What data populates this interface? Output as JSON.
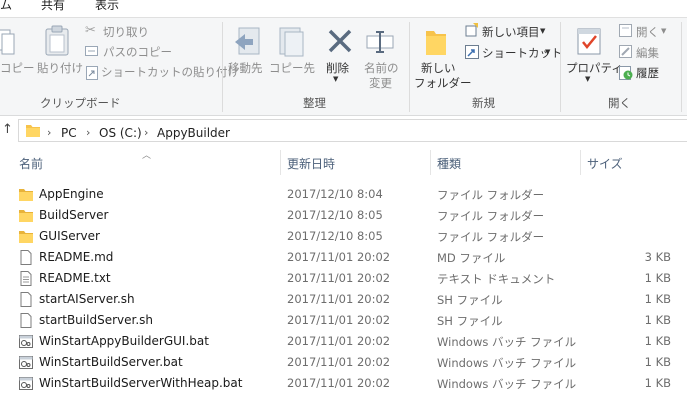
{
  "ribbon_tabs": [
    "ム",
    "共有",
    "表示"
  ],
  "clipboard": {
    "copy": "コピー",
    "paste": "貼り付け",
    "cut": "切り取り",
    "copy_path": "パスのコピー",
    "paste_shortcut": "ショートカットの貼り付け",
    "group": "クリップボード"
  },
  "organize": {
    "move_to": "移動先",
    "copy_to": "コピー先",
    "delete": "削除",
    "rename_1": "名前の",
    "rename_2": "変更",
    "group": "整理"
  },
  "new": {
    "new_folder_1": "新しい",
    "new_folder_2": "フォルダー",
    "new_item": "新しい項目",
    "shortcut": "ショートカット",
    "group": "新規"
  },
  "open": {
    "properties": "プロパティ",
    "open": "開く",
    "edit": "編集",
    "history": "履歴",
    "group": "開く"
  },
  "breadcrumb": [
    "PC",
    "OS (C:)",
    "AppyBuilder"
  ],
  "columns": {
    "name": "名前",
    "date": "更新日時",
    "type": "種類",
    "size": "サイズ"
  },
  "files": [
    {
      "name": "AppEngine",
      "date": "2017/12/10 8:04",
      "type": "ファイル フォルダー",
      "size": "",
      "icon": "folder-icon"
    },
    {
      "name": "BuildServer",
      "date": "2017/12/10 8:05",
      "type": "ファイル フォルダー",
      "size": "",
      "icon": "folder-icon"
    },
    {
      "name": "GUIServer",
      "date": "2017/12/10 8:05",
      "type": "ファイル フォルダー",
      "size": "",
      "icon": "folder-icon"
    },
    {
      "name": "README.md",
      "date": "2017/11/01 20:02",
      "type": "MD ファイル",
      "size": "3 KB",
      "icon": "document-icon"
    },
    {
      "name": "README.txt",
      "date": "2017/11/01 20:02",
      "type": "テキスト ドキュメント",
      "size": "1 KB",
      "icon": "text-document-icon"
    },
    {
      "name": "startAIServer.sh",
      "date": "2017/11/01 20:02",
      "type": "SH ファイル",
      "size": "1 KB",
      "icon": "document-icon"
    },
    {
      "name": "startBuildServer.sh",
      "date": "2017/11/01 20:02",
      "type": "SH ファイル",
      "size": "1 KB",
      "icon": "document-icon"
    },
    {
      "name": "WinStartAppyBuilderGUI.bat",
      "date": "2017/11/01 20:02",
      "type": "Windows バッチ ファイル",
      "size": "1 KB",
      "icon": "batch-file-icon"
    },
    {
      "name": "WinStartBuildServer.bat",
      "date": "2017/11/01 20:02",
      "type": "Windows バッチ ファイル",
      "size": "1 KB",
      "icon": "batch-file-icon"
    },
    {
      "name": "WinStartBuildServerWithHeap.bat",
      "date": "2017/11/01 20:02",
      "type": "Windows バッチ ファイル",
      "size": "1 KB",
      "icon": "batch-file-icon"
    }
  ]
}
